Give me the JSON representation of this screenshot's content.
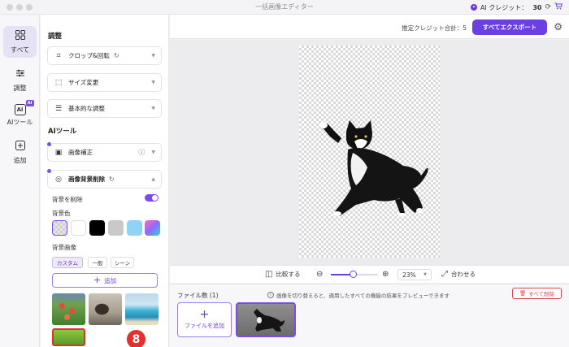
{
  "window": {
    "title": "一括画像エディター"
  },
  "credits": {
    "label": "AI クレジット：",
    "value": "30",
    "dot_text": "✦"
  },
  "nav": {
    "items": [
      {
        "label": "すべて",
        "icon": "grid-icon"
      },
      {
        "label": "調整",
        "icon": "sliders-icon"
      },
      {
        "label": "AIツール",
        "icon": "ai-icon",
        "badge": "AI",
        "glyph": "Ai"
      },
      {
        "label": "追加",
        "icon": "plus-box-icon"
      }
    ]
  },
  "panel": {
    "adjust_title": "調整",
    "crop_label": "クロップ&回転",
    "resize_label": "サイズ変更",
    "basic_label": "基本的な調整",
    "ai_title": "AIツール",
    "enhance_label": "画像補正",
    "bg_remove_label": "画像背景削除",
    "remove_bg_label": "背景を削除",
    "bg_color_label": "背景色",
    "bg_image_label": "背景画像",
    "chips": [
      "カスタム",
      "一般",
      "シーン"
    ],
    "add_label": "追加",
    "marker": "8"
  },
  "topbar": {
    "estimate": "推定クレジット合計：5",
    "export": "すべてエクスポート"
  },
  "zoombar": {
    "compare": "比較する",
    "zoom": "23%",
    "zoom_fraction": 0.23,
    "fit": "合わせる"
  },
  "files": {
    "count_label": "ファイル数 (1)",
    "hint": "画像を切り替えると、適用したすべての機能の結果をプレビューできます",
    "delete_all": "すべて削除",
    "add_file": "ファイルを追加"
  },
  "colors": {
    "accent": "#6b3fe3",
    "danger": "#e0474c"
  }
}
